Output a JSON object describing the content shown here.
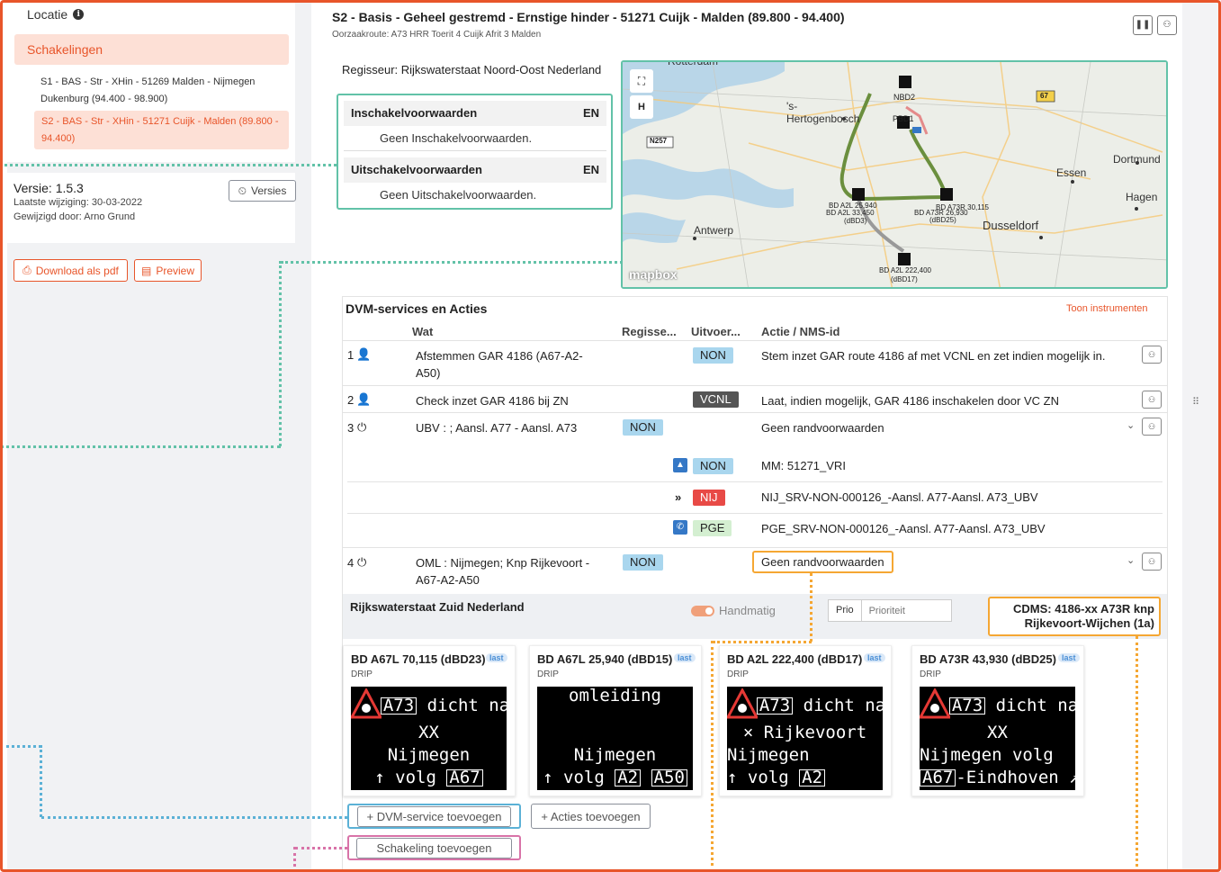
{
  "sidebar": {
    "locatie_label": "Locatie",
    "schakelingen_label": "Schakelingen",
    "items": [
      {
        "label": "S1 - BAS - Str - XHin - 51269 Malden - Nijmegen Dukenburg (94.400 - 98.900)"
      },
      {
        "label": "S2 - BAS - Str - XHin - 51271 Cuijk - Malden (89.800 - 94.400)"
      }
    ],
    "versie": "Versie: 1.5.3",
    "laatste_wijziging": "Laatste wijziging: 30-03-2022",
    "gewijzigd_door": "Gewijzigd door: Arno Grund",
    "versies_button": "Versies",
    "download_button": "Download als pdf",
    "preview_button": "Preview"
  },
  "header": {
    "title": "S2 - Basis - Geheel gestremd - Ernstige hinder - 51271 Cuijk - Malden (89.800 - 94.400)",
    "subtitle": "Oorzaakroute: A73 HRR Toerit 4 Cuijk Afrit 3 Malden"
  },
  "regisseur": "Regisseur: Rijkswaterstaat Noord-Oost Nederland",
  "voorwaarden": {
    "in_title": "Inschakelvoorwaarden",
    "in_lang": "EN",
    "in_empty": "Geen Inschakelvoorwaarden.",
    "uit_title": "Uitschakelvoorwaarden",
    "uit_lang": "EN",
    "uit_empty": "Geen Uitschakelvoorwaarden."
  },
  "map": {
    "cities": [
      "Rotterdam",
      "'s-Hertogenbosch",
      "Essen",
      "Dortmund",
      "Hagen",
      "Antwerp",
      "Dusseldorf"
    ],
    "roads": [
      "N257",
      "67"
    ],
    "markers": [
      "NBD2",
      "PBD1",
      "BD A2L 25,940",
      "BD A2L 33,450",
      "(dBD3)",
      "BD A73R 30,115",
      "BD A73R 26,930",
      "(dBD25)",
      "BD A2L 222,400",
      "(dBD17)"
    ],
    "logo": "mapbox",
    "ctrl_fullscreen": "⛶",
    "ctrl_h": "H"
  },
  "dvm": {
    "title": "DVM-services en Acties",
    "toon_instrumenten": "Toon instrumenten",
    "columns": [
      "Wat",
      "Regisse...",
      "Uitvoer...",
      "Actie / NMS-id"
    ],
    "rows": [
      {
        "num": "1",
        "icon": "person-icon",
        "wat": "Afstemmen GAR 4186 (A67-A2-A50)",
        "uitvoerder": "NON",
        "actie": "Stem inzet GAR route 4186 af met VCNL en zet indien mogelijk in."
      },
      {
        "num": "2",
        "icon": "person-icon",
        "wat": "Check inzet GAR 4186 bij ZN",
        "uitvoerder": "VCNL",
        "actie": "Laat, indien mogelijk, GAR 4186 inschakelen door VC ZN"
      },
      {
        "num": "3",
        "icon": "power-icon",
        "wat": "UBV : ; Aansl. A77 - Aansl. A73",
        "regisseur": "NON",
        "actie": "Geen randvoorwaarden",
        "subs": [
          {
            "badge": "NON",
            "actie": "MM: 51271_VRI"
          },
          {
            "badge": "NIJ",
            "actie": "NIJ_SRV-NON-000126_-Aansl. A77-Aansl. A73_UBV"
          },
          {
            "badge": "PGE",
            "actie": "PGE_SRV-NON-000126_-Aansl. A77-Aansl. A73_UBV"
          }
        ]
      },
      {
        "num": "4",
        "icon": "power-icon",
        "wat": "OML : Nijmegen; Knp Rijkevoort - A67-A2-A50",
        "regisseur": "NON",
        "actie": "Geen randvoorwaarden"
      }
    ],
    "rws": {
      "title": "Rijkswaterstaat Zuid Nederland",
      "handmatig": "Handmatig",
      "prio_label": "Prio",
      "prio_placeholder": "Prioriteit",
      "cdms": "CDMS: 4186-xx A73R knp Rijkevoort-Wijchen (1a)"
    },
    "drips": [
      {
        "title": "BD A67L 70,115 (dBD23)",
        "type": "DRIP",
        "last": "last",
        "lines": [
          {
            "text": "A73 dicht na",
            "warn": true,
            "box": "A73"
          },
          {
            "text": "XX"
          },
          {
            "text": "Nijmegen"
          },
          {
            "text": "volg",
            "arrow": "↑",
            "box2": "A67"
          }
        ]
      },
      {
        "title": "BD A67L 25,940 (dBD15)",
        "type": "DRIP",
        "last": "last",
        "lines": [
          {
            "text": "omleiding"
          },
          {
            "text": ""
          },
          {
            "text": "Nijmegen"
          },
          {
            "text": "volg",
            "arrow": "↑",
            "box2": "A2",
            "box3": "A50"
          }
        ]
      },
      {
        "title": "BD A2L 222,400 (dBD17)",
        "type": "DRIP",
        "last": "last",
        "lines": [
          {
            "text": "A73 dicht na",
            "warn": true,
            "box": "A73"
          },
          {
            "text": "Rijkevoort",
            "x": true
          },
          {
            "text": "Nijmegen"
          },
          {
            "text": "volg",
            "arrow": "↑",
            "box2": "A2"
          }
        ]
      },
      {
        "title": "BD A73R 43,930 (dBD25)",
        "type": "DRIP",
        "last": "last",
        "lines": [
          {
            "text": "A73 dicht na",
            "warn": true,
            "box": "A73"
          },
          {
            "text": "XX"
          },
          {
            "text": "Nijmegen volg"
          },
          {
            "text": "-Eindhoven",
            "box2": "A67",
            "arrowr": "↗"
          }
        ]
      }
    ],
    "add_dvm": "+ DVM-service toevoegen",
    "add_acties": "+ Acties toevoegen",
    "add_schakeling": "Schakeling toevoegen"
  },
  "colors": {
    "accent": "#e8552a",
    "teal": "#62c2a8",
    "blue": "#5bb1d6",
    "pink": "#d873a8",
    "amber": "#f5a733"
  }
}
